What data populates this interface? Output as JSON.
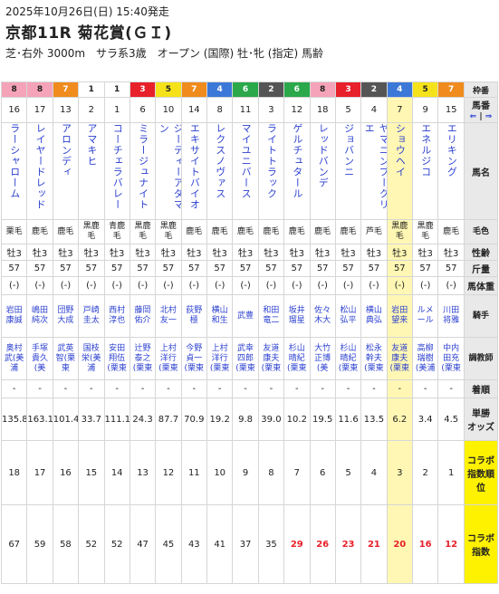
{
  "header": {
    "date": "2025年10月26日(日) 15:40発走",
    "title": "京都11R 菊花賞(ＧＩ)",
    "conditions": "芝･右外 3000m　サラ系3歳　オープン (国際) 牡･牝 (指定) 馬齢"
  },
  "labels": {
    "waku": "枠番",
    "umaban": "馬番",
    "sort_asc": "⇐",
    "sort_mid": "|",
    "sort_desc": "⇒",
    "name": "馬名",
    "coat": "毛色",
    "sex": "性齢",
    "kinryo": "斤量",
    "bw": "馬体重",
    "jockey": "騎手",
    "trainer": "調教師",
    "chaku": "着順",
    "odds_1": "単勝",
    "odds_2": "オッズ",
    "rank_1": "コラボ",
    "rank_2": "指数順位",
    "score_1": "コラボ",
    "score_2": "指数"
  },
  "horses": [
    {
      "waku": "8",
      "umaban": "16",
      "name": "ラーシャローム",
      "coat_1": "栗毛",
      "coat_2": "",
      "sex": "牡3",
      "kinryo": "57",
      "bw": "(-)",
      "jockey_1": "岩田",
      "jockey_2": "康誠",
      "trainer_1": "奥村",
      "trainer_2": "武(美浦",
      "chaku": "-",
      "odds": "135.8",
      "rank": "18",
      "score": "67",
      "score_red": false
    },
    {
      "waku": "8",
      "umaban": "17",
      "name": "レイヤードレッド",
      "coat_1": "鹿毛",
      "coat_2": "",
      "sex": "牡3",
      "kinryo": "57",
      "bw": "(-)",
      "jockey_1": "嶋田",
      "jockey_2": "純次",
      "trainer_1": "手塚",
      "trainer_2": "貴久(美",
      "chaku": "-",
      "odds": "163.1",
      "rank": "17",
      "score": "59",
      "score_red": false
    },
    {
      "waku": "7",
      "umaban": "13",
      "name": "アロンディ",
      "coat_1": "鹿毛",
      "coat_2": "",
      "sex": "牡3",
      "kinryo": "57",
      "bw": "(-)",
      "jockey_1": "団野",
      "jockey_2": "大成",
      "trainer_1": "武英",
      "trainer_2": "智(栗東",
      "chaku": "-",
      "odds": "101.4",
      "rank": "16",
      "score": "58",
      "score_red": false
    },
    {
      "waku": "1",
      "umaban": "2",
      "name": "アマキヒ",
      "coat_1": "黒鹿",
      "coat_2": "毛",
      "sex": "牡3",
      "kinryo": "57",
      "bw": "(-)",
      "jockey_1": "戸崎",
      "jockey_2": "圭太",
      "trainer_1": "国枝",
      "trainer_2": "栄(美浦",
      "chaku": "-",
      "odds": "33.7",
      "rank": "15",
      "score": "52",
      "score_red": false
    },
    {
      "waku": "1",
      "umaban": "1",
      "name": "コーチェラバレー",
      "coat_1": "青鹿",
      "coat_2": "毛",
      "sex": "牡3",
      "kinryo": "57",
      "bw": "(-)",
      "jockey_1": "西村",
      "jockey_2": "淳也",
      "trainer_1": "安田",
      "trainer_2": "翔伍(栗東",
      "chaku": "-",
      "odds": "111.1",
      "rank": "14",
      "score": "52",
      "score_red": false
    },
    {
      "waku": "3",
      "umaban": "6",
      "name": "ミラージュナイト",
      "coat_1": "黒鹿",
      "coat_2": "毛",
      "sex": "牡3",
      "kinryo": "57",
      "bw": "(-)",
      "jockey_1": "藤岡",
      "jockey_2": "佑介",
      "trainer_1": "辻野",
      "trainer_2": "泰之(栗東",
      "chaku": "-",
      "odds": "24.3",
      "rank": "13",
      "score": "47",
      "score_red": false
    },
    {
      "waku": "5",
      "umaban": "10",
      "name": "ジーティーアダマン",
      "coat_1": "黒鹿",
      "coat_2": "毛",
      "sex": "牡3",
      "kinryo": "57",
      "bw": "(-)",
      "jockey_1": "北村",
      "jockey_2": "友一",
      "trainer_1": "上村",
      "trainer_2": "洋行(栗東",
      "chaku": "-",
      "odds": "87.7",
      "rank": "12",
      "score": "45",
      "score_red": false
    },
    {
      "waku": "7",
      "umaban": "14",
      "name": "エキサイトバイオ",
      "coat_1": "鹿毛",
      "coat_2": "",
      "sex": "牡3",
      "kinryo": "57",
      "bw": "(-)",
      "jockey_1": "荻野",
      "jockey_2": "極",
      "trainer_1": "今野",
      "trainer_2": "貞一(栗東",
      "chaku": "-",
      "odds": "70.9",
      "rank": "11",
      "score": "43",
      "score_red": false
    },
    {
      "waku": "4",
      "umaban": "8",
      "name": "レクスノヴァス",
      "coat_1": "鹿毛",
      "coat_2": "",
      "sex": "牡3",
      "kinryo": "57",
      "bw": "(-)",
      "jockey_1": "横山",
      "jockey_2": "和生",
      "trainer_1": "上村",
      "trainer_2": "洋行(栗東",
      "chaku": "-",
      "odds": "19.2",
      "rank": "10",
      "score": "41",
      "score_red": false
    },
    {
      "waku": "6",
      "umaban": "11",
      "name": "マイユニバース",
      "coat_1": "鹿毛",
      "coat_2": "",
      "sex": "牡3",
      "kinryo": "57",
      "bw": "(-)",
      "jockey_1": "武豊",
      "jockey_2": "",
      "trainer_1": "武幸",
      "trainer_2": "四郎(栗東",
      "chaku": "-",
      "odds": "9.8",
      "rank": "9",
      "score": "37",
      "score_red": false
    },
    {
      "waku": "2",
      "umaban": "3",
      "name": "ライトトラック",
      "coat_1": "鹿毛",
      "coat_2": "",
      "sex": "牡3",
      "kinryo": "57",
      "bw": "(-)",
      "jockey_1": "和田",
      "jockey_2": "竜二",
      "trainer_1": "友道",
      "trainer_2": "康夫(栗東",
      "chaku": "-",
      "odds": "39.0",
      "rank": "8",
      "score": "35",
      "score_red": false
    },
    {
      "waku": "6",
      "umaban": "12",
      "name": "ゲルチュタール",
      "coat_1": "鹿毛",
      "coat_2": "",
      "sex": "牡3",
      "kinryo": "57",
      "bw": "(-)",
      "jockey_1": "坂井",
      "jockey_2": "瑠星",
      "trainer_1": "杉山",
      "trainer_2": "晴紀(栗東",
      "chaku": "-",
      "odds": "10.2",
      "rank": "7",
      "score": "29",
      "score_red": true
    },
    {
      "waku": "8",
      "umaban": "18",
      "name": "レッドバンデ",
      "coat_1": "鹿毛",
      "coat_2": "",
      "sex": "牡3",
      "kinryo": "57",
      "bw": "(-)",
      "jockey_1": "佐々",
      "jockey_2": "木大",
      "trainer_1": "大竹",
      "trainer_2": "正博(美",
      "chaku": "-",
      "odds": "19.5",
      "rank": "6",
      "score": "26",
      "score_red": true
    },
    {
      "waku": "3",
      "umaban": "5",
      "name": "ジョバンニ",
      "coat_1": "鹿毛",
      "coat_2": "",
      "sex": "牡3",
      "kinryo": "57",
      "bw": "(-)",
      "jockey_1": "松山",
      "jockey_2": "弘平",
      "trainer_1": "杉山",
      "trainer_2": "晴紀(栗東",
      "chaku": "-",
      "odds": "11.6",
      "rank": "5",
      "score": "23",
      "score_red": true
    },
    {
      "waku": "2",
      "umaban": "4",
      "name": "ヤマニンブークリエ",
      "coat_1": "芦毛",
      "coat_2": "",
      "sex": "牡3",
      "kinryo": "57",
      "bw": "(-)",
      "jockey_1": "横山",
      "jockey_2": "典弘",
      "trainer_1": "松永",
      "trainer_2": "幹夫(栗東",
      "chaku": "-",
      "odds": "13.5",
      "rank": "4",
      "score": "21",
      "score_red": true
    },
    {
      "waku": "4",
      "umaban": "7",
      "name": "ショウヘイ",
      "coat_1": "黒鹿",
      "coat_2": "毛",
      "sex": "牡3",
      "kinryo": "57",
      "bw": "(-)",
      "jockey_1": "岩田",
      "jockey_2": "望来",
      "trainer_1": "友道",
      "trainer_2": "康夫(栗東",
      "chaku": "-",
      "odds": "6.2",
      "rank": "3",
      "score": "20",
      "score_red": true
    },
    {
      "waku": "5",
      "umaban": "9",
      "name": "エネルジコ",
      "coat_1": "黒鹿",
      "coat_2": "毛",
      "sex": "牡3",
      "kinryo": "57",
      "bw": "(-)",
      "jockey_1": "ルメ",
      "jockey_2": "ール",
      "trainer_1": "高柳",
      "trainer_2": "瑞樹(美浦",
      "chaku": "-",
      "odds": "3.4",
      "rank": "2",
      "score": "16",
      "score_red": true
    },
    {
      "waku": "7",
      "umaban": "15",
      "name": "エリキング",
      "coat_1": "鹿毛",
      "coat_2": "",
      "sex": "牡3",
      "kinryo": "57",
      "bw": "(-)",
      "jockey_1": "川田",
      "jockey_2": "将雅",
      "trainer_1": "中内",
      "trainer_2": "田充(栗東",
      "chaku": "-",
      "odds": "4.5",
      "rank": "1",
      "score": "12",
      "score_red": true
    }
  ],
  "highlight_index": 15
}
